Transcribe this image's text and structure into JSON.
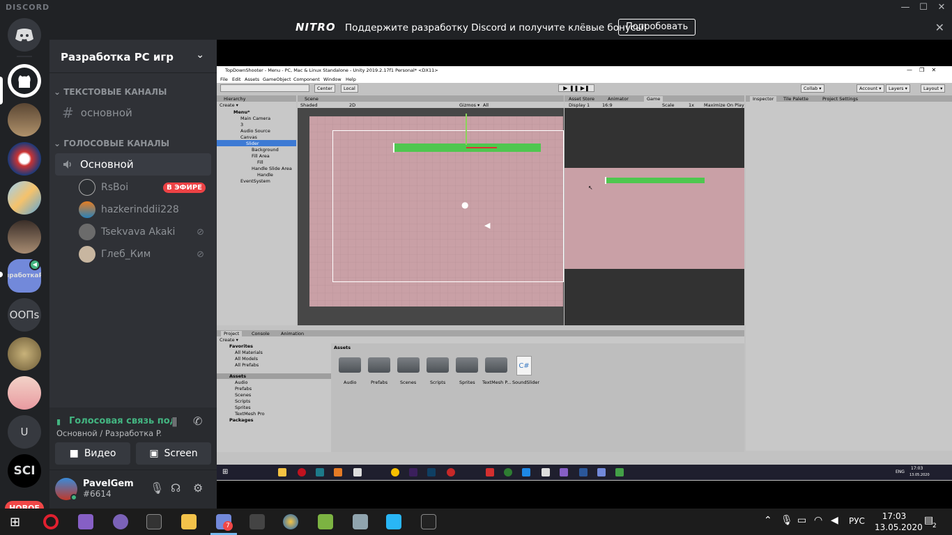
{
  "titlebar": {
    "brand": "DISCORD",
    "minimize": "—",
    "maximize": "☐",
    "close": "✕"
  },
  "nitro": {
    "logo": "NITRO",
    "message": "Поддержите разработку Discord и получите клёвые бонусы!",
    "button": "Попробовать",
    "close": "✕"
  },
  "guilds": {
    "new_badge": "НОВОЕ",
    "labels": {
      "dev": "зработкаР",
      "oop": "ООПs",
      "u": "U",
      "sci": "SCI"
    }
  },
  "server": {
    "name": "Разработка PC игр"
  },
  "categories": {
    "text": "ТЕКСТОВЫЕ КАНАЛЫ",
    "voice": "ГОЛОСОВЫЕ КАНАЛЫ"
  },
  "channels": {
    "text_main": "основной",
    "voice_main": "Основной"
  },
  "voice_users": [
    {
      "name": "RsBoi",
      "badge": "В ЭФИРЕ"
    },
    {
      "name": "hazkerinddii228"
    },
    {
      "name": "Tsekvava Akaki"
    },
    {
      "name": "Глеб_Ким"
    }
  ],
  "voice_panel": {
    "status": "Голосовая связь подключена",
    "sub": "Основной / Разработка P...",
    "video": "Видео",
    "screen": "Screen"
  },
  "user": {
    "name": "PavelGem",
    "tag": "#6614"
  },
  "unity": {
    "title": "TopDownShooter - Menu - PC, Mac & Linux Standalone - Unity 2019.2.17f1 Personal* <DX11>",
    "menu": [
      "File",
      "Edit",
      "Assets",
      "GameObject",
      "Component",
      "Window",
      "Help"
    ],
    "toolbar": {
      "center": "Center",
      "local": "Local",
      "collab": "Collab ▾",
      "account": "Account ▾",
      "layers": "Layers ▾",
      "layout": "Layout ▾"
    },
    "tabs": {
      "hierarchy": "Hierarchy",
      "scene": "Scene",
      "asset_store": "Asset Store",
      "animator": "Animator",
      "game": "Game",
      "inspector": "Inspector",
      "tile_palette": "Tile Palette",
      "project_settings": "Project Settings",
      "project": "Project",
      "console": "Console",
      "animation": "Animation"
    },
    "scene_bar": {
      "shaded": "Shaded",
      "mode": "2D",
      "gizmos": "Gizmos ▾",
      "search": "All"
    },
    "game_bar": {
      "display": "Display 1",
      "aspect": "16:9",
      "scale_label": "Scale",
      "scale_value": "1x",
      "maximize": "Maximize On Play"
    },
    "hierarchy": [
      "Menu*",
      "Main Camera",
      "3",
      "Audio Source",
      "Canvas",
      "Slider",
      "Background",
      "Fill Area",
      "Fill",
      "Handle Slide Area",
      "Handle",
      "EventSystem"
    ],
    "favorites": {
      "title": "Favorites",
      "items": [
        "All Materials",
        "All Models",
        "All Prefabs"
      ]
    },
    "assets_tree": {
      "title": "Assets",
      "items": [
        "Audio",
        "Prefabs",
        "Scenes",
        "Scripts",
        "Sprites",
        "TextMesh Pro"
      ],
      "packages": "Packages"
    },
    "assets_header": "Assets",
    "asset_items": [
      "Audio",
      "Prefabs",
      "Scenes",
      "Scripts",
      "Sprites",
      "TextMesh P...",
      "SoundSlider"
    ],
    "create": "Create ▾",
    "slider_value": 1.0,
    "inner_clock": {
      "time": "17:03",
      "date": "13.05.2020",
      "lang": "ENG"
    }
  },
  "taskbar": {
    "lang": "РУС",
    "time": "17:03",
    "date": "13.05.2020",
    "notif": "2"
  },
  "colors": {
    "bg": "#202225",
    "sidebar": "#2f3136",
    "accent": "#7289da",
    "green": "#43b581",
    "red": "#f04747",
    "scene_pink": "#c9a0a6",
    "slider_green": "#4fc74f"
  }
}
